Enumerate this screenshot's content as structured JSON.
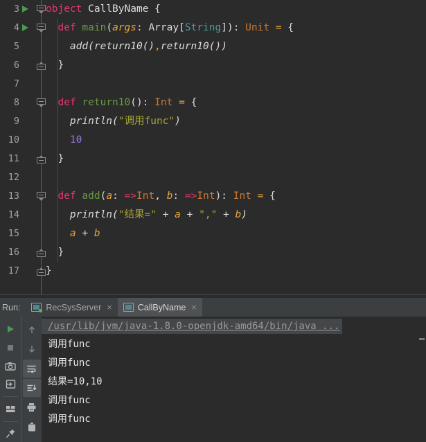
{
  "editor": {
    "lines": [
      {
        "num": "3",
        "run": true,
        "fold": "down",
        "indent": 0,
        "tokens": [
          {
            "t": "object",
            "c": "kw-pink"
          },
          {
            "t": " ",
            "c": "plain"
          },
          {
            "t": "CallByName",
            "c": "plain"
          },
          {
            "t": " {",
            "c": "plain"
          }
        ]
      },
      {
        "num": "4",
        "run": true,
        "fold": "down",
        "indent": 1,
        "tokens": [
          {
            "t": "  ",
            "c": "plain"
          },
          {
            "t": "def",
            "c": "kw-pink"
          },
          {
            "t": " ",
            "c": "plain"
          },
          {
            "t": "main",
            "c": "fn"
          },
          {
            "t": "(",
            "c": "plain"
          },
          {
            "t": "args",
            "c": "param"
          },
          {
            "t": ": ",
            "c": "plain"
          },
          {
            "t": "Array",
            "c": "plain"
          },
          {
            "t": "[",
            "c": "plain"
          },
          {
            "t": "String",
            "c": "type-t"
          },
          {
            "t": "]): ",
            "c": "plain"
          },
          {
            "t": "Unit",
            "c": "type"
          },
          {
            "t": " ",
            "c": "plain"
          },
          {
            "t": "=",
            "c": "op"
          },
          {
            "t": " {",
            "c": "plain"
          }
        ]
      },
      {
        "num": "5",
        "run": false,
        "fold": "",
        "indent": 1,
        "tokens": [
          {
            "t": "    ",
            "c": "plain"
          },
          {
            "t": "add",
            "c": "ital"
          },
          {
            "t": "(",
            "c": "ital"
          },
          {
            "t": "return10",
            "c": "ital"
          },
          {
            "t": "()",
            "c": "ital"
          },
          {
            "t": ",",
            "c": "op"
          },
          {
            "t": "return10",
            "c": "ital"
          },
          {
            "t": "())",
            "c": "ital"
          }
        ]
      },
      {
        "num": "6",
        "run": false,
        "fold": "up",
        "indent": 1,
        "tokens": [
          {
            "t": "  }",
            "c": "plain"
          }
        ]
      },
      {
        "num": "7",
        "run": false,
        "fold": "",
        "indent": 1,
        "tokens": []
      },
      {
        "num": "8",
        "run": false,
        "fold": "down",
        "indent": 1,
        "tokens": [
          {
            "t": "  ",
            "c": "plain"
          },
          {
            "t": "def",
            "c": "kw-pink"
          },
          {
            "t": " ",
            "c": "plain"
          },
          {
            "t": "return10",
            "c": "fn"
          },
          {
            "t": "(): ",
            "c": "plain"
          },
          {
            "t": "Int",
            "c": "type"
          },
          {
            "t": " ",
            "c": "plain"
          },
          {
            "t": "=",
            "c": "op"
          },
          {
            "t": " {",
            "c": "plain"
          }
        ]
      },
      {
        "num": "9",
        "run": false,
        "fold": "",
        "indent": 1,
        "tokens": [
          {
            "t": "    ",
            "c": "plain"
          },
          {
            "t": "println",
            "c": "ital"
          },
          {
            "t": "(",
            "c": "ital"
          },
          {
            "t": "\"调用func\"",
            "c": "str"
          },
          {
            "t": ")",
            "c": "ital"
          }
        ]
      },
      {
        "num": "10",
        "run": false,
        "fold": "",
        "indent": 1,
        "tokens": [
          {
            "t": "    ",
            "c": "plain"
          },
          {
            "t": "10",
            "c": "num"
          }
        ]
      },
      {
        "num": "11",
        "run": false,
        "fold": "up",
        "indent": 1,
        "tokens": [
          {
            "t": "  }",
            "c": "plain"
          }
        ]
      },
      {
        "num": "12",
        "run": false,
        "fold": "",
        "indent": 1,
        "tokens": []
      },
      {
        "num": "13",
        "run": false,
        "fold": "down",
        "indent": 1,
        "tokens": [
          {
            "t": "  ",
            "c": "plain"
          },
          {
            "t": "def",
            "c": "kw-pink"
          },
          {
            "t": " ",
            "c": "plain"
          },
          {
            "t": "add",
            "c": "fn"
          },
          {
            "t": "(",
            "c": "plain"
          },
          {
            "t": "a",
            "c": "param"
          },
          {
            "t": ": ",
            "c": "plain"
          },
          {
            "t": "=>",
            "c": "arrow"
          },
          {
            "t": "Int",
            "c": "type"
          },
          {
            "t": ", ",
            "c": "plain"
          },
          {
            "t": "b",
            "c": "param"
          },
          {
            "t": ": ",
            "c": "plain"
          },
          {
            "t": "=>",
            "c": "arrow"
          },
          {
            "t": "Int",
            "c": "type"
          },
          {
            "t": "): ",
            "c": "plain"
          },
          {
            "t": "Int",
            "c": "type"
          },
          {
            "t": " ",
            "c": "plain"
          },
          {
            "t": "=",
            "c": "op"
          },
          {
            "t": " {",
            "c": "plain"
          }
        ]
      },
      {
        "num": "14",
        "run": false,
        "fold": "",
        "indent": 1,
        "tokens": [
          {
            "t": "    ",
            "c": "plain"
          },
          {
            "t": "println",
            "c": "ital"
          },
          {
            "t": "(",
            "c": "ital"
          },
          {
            "t": "\"结果=\"",
            "c": "str"
          },
          {
            "t": " + ",
            "c": "plain"
          },
          {
            "t": "a",
            "c": "param"
          },
          {
            "t": " + ",
            "c": "plain"
          },
          {
            "t": "\",\"",
            "c": "str"
          },
          {
            "t": " + ",
            "c": "plain"
          },
          {
            "t": "b",
            "c": "param"
          },
          {
            "t": ")",
            "c": "ital"
          }
        ]
      },
      {
        "num": "15",
        "run": false,
        "fold": "",
        "indent": 1,
        "tokens": [
          {
            "t": "    ",
            "c": "plain"
          },
          {
            "t": "a",
            "c": "param"
          },
          {
            "t": " + ",
            "c": "plain"
          },
          {
            "t": "b",
            "c": "param"
          }
        ]
      },
      {
        "num": "16",
        "run": false,
        "fold": "up",
        "indent": 1,
        "tokens": [
          {
            "t": "  }",
            "c": "plain"
          }
        ]
      },
      {
        "num": "17",
        "run": false,
        "fold": "up",
        "indent": 0,
        "tokens": [
          {
            "t": "}",
            "c": "plain"
          }
        ]
      }
    ]
  },
  "run_panel": {
    "label": "Run:",
    "tabs": [
      {
        "name": "RecSysServer",
        "active": false,
        "running": true,
        "close": "×"
      },
      {
        "name": "CallByName",
        "active": true,
        "running": false,
        "close": "×"
      }
    ],
    "toolbar_left": [
      {
        "icon": "rerun-icon",
        "name": "rerun-button"
      },
      {
        "icon": "stop-icon",
        "name": "stop-button"
      },
      {
        "icon": "camera-icon",
        "name": "dump-threads-button"
      },
      {
        "icon": "export-icon",
        "name": "export-button"
      },
      {
        "icon": "layout-icon",
        "name": "layout-button"
      },
      {
        "icon": "pin-icon",
        "name": "pin-tab-button"
      }
    ],
    "toolbar_right": [
      {
        "icon": "arrow-up-icon",
        "name": "previous-occurrence-button"
      },
      {
        "icon": "arrow-down-icon",
        "name": "next-occurrence-button"
      },
      {
        "icon": "soft-wrap-icon",
        "name": "soft-wrap-button"
      },
      {
        "icon": "scroll-end-icon",
        "name": "scroll-to-end-button"
      },
      {
        "icon": "print-icon",
        "name": "print-button"
      },
      {
        "icon": "trash-icon",
        "name": "clear-all-button"
      }
    ],
    "console": {
      "command": "/usr/lib/jvm/java-1.8.0-openjdk-amd64/bin/java ...",
      "output": [
        "调用func",
        "调用func",
        "结果=10,10",
        "调用func",
        "调用func"
      ]
    }
  },
  "colors": {
    "editor_bg": "#2b2b2b",
    "panel_bg": "#3c3f41",
    "keyword": "#e8366b",
    "method": "#6a9b41",
    "parameter": "#e8a33d",
    "type": "#cc7832",
    "string": "#a5a531",
    "number": "#9876ea",
    "run_green": "#499c54"
  }
}
